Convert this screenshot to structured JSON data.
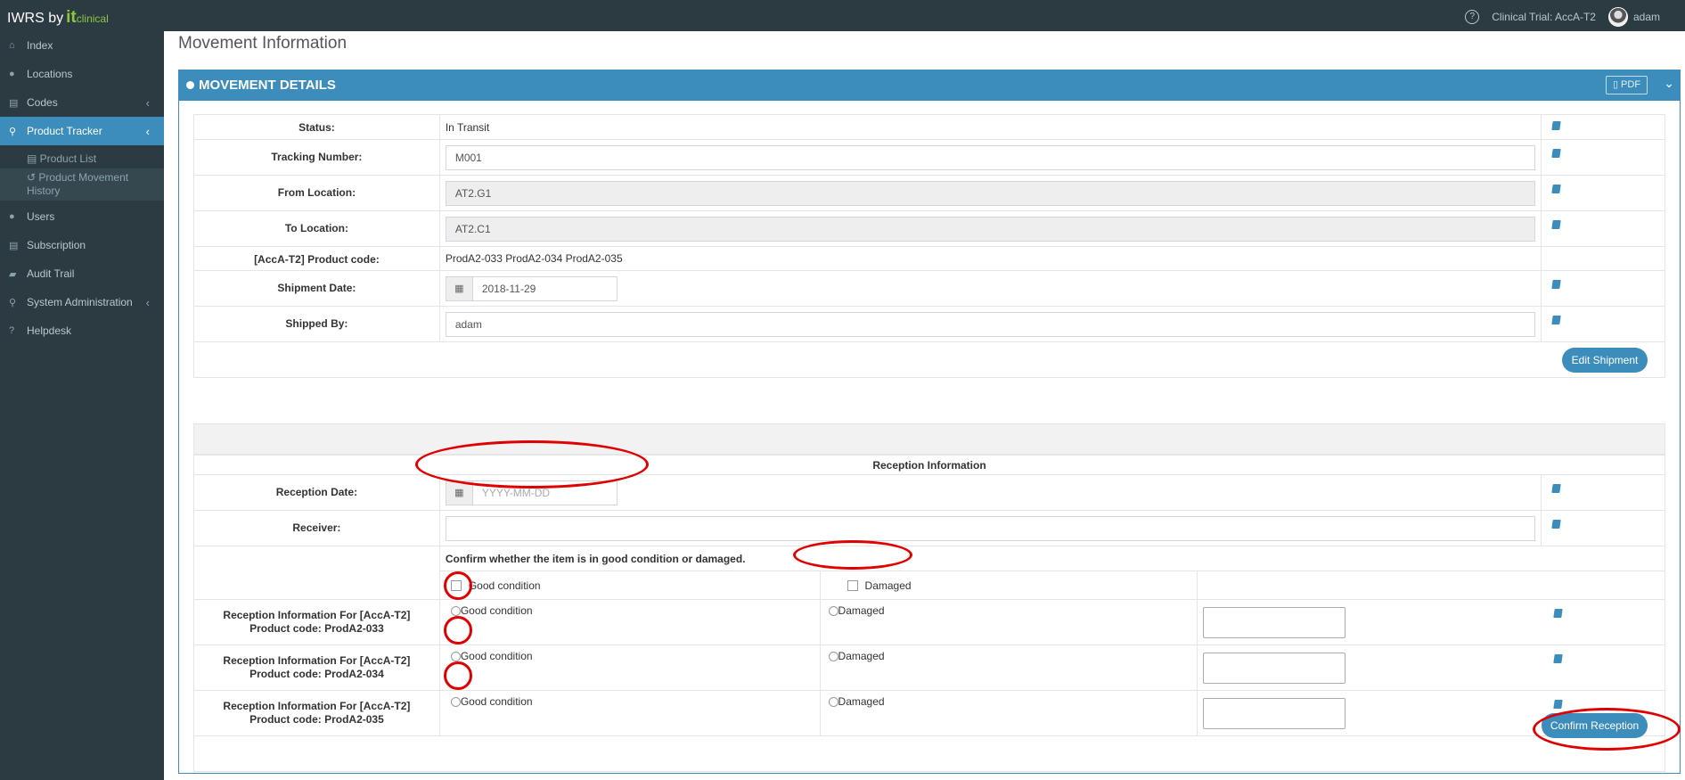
{
  "topbar": {
    "brand_prefix": "IWRS by",
    "brand_it": "it",
    "brand_clinical": "clinical",
    "help_label": "?",
    "trial": "Clinical Trial: AccA-T2",
    "user": "adam"
  },
  "sidebar": {
    "items": [
      {
        "label": "Index",
        "icon": "home-icon"
      },
      {
        "label": "Locations",
        "icon": "globe-icon"
      },
      {
        "label": "Codes",
        "icon": "table-icon"
      },
      {
        "label": "Product Tracker",
        "icon": "map-marker-icon"
      },
      {
        "label": "Users",
        "icon": "users-icon"
      },
      {
        "label": "Subscription",
        "icon": "table-icon"
      },
      {
        "label": "Audit Trail",
        "icon": "book-icon"
      },
      {
        "label": "System Administration",
        "icon": "map-marker-icon"
      },
      {
        "label": "Helpdesk",
        "icon": "question-icon"
      }
    ],
    "subitems": [
      {
        "label": "Product List",
        "icon": "table-icon"
      },
      {
        "label": "Product Movement History",
        "icon": "history-icon"
      }
    ]
  },
  "page": {
    "title": "Movement Information"
  },
  "box": {
    "title": "MOVEMENT DETAILS",
    "pdf_label": "PDF"
  },
  "movement": {
    "status_label": "Status:",
    "status_value": "In Transit",
    "tracking_label": "Tracking Number:",
    "tracking_value": "M001",
    "from_label": "From Location:",
    "from_value": "AT2.G1",
    "to_label": "To Location:",
    "to_value": "AT2.C1",
    "product_code_label": "[AccA-T2] Product code:",
    "product_code_value": "ProdA2-033 ProdA2-034 ProdA2-035",
    "shipment_date_label": "Shipment Date:",
    "shipment_date_value": "2018-11-29",
    "shipped_by_label": "Shipped By:",
    "shipped_by_value": "adam",
    "edit_button": "Edit Shipment"
  },
  "reception": {
    "header": "Reception Information",
    "date_label": "Reception Date:",
    "date_placeholder": "YYYY-MM-DD",
    "receiver_label": "Receiver:",
    "receiver_value": "",
    "confirm_prompt": "Confirm whether the item is in good condition or damaged.",
    "good_label": "Good condition",
    "damaged_label": "Damaged",
    "products": [
      {
        "label": "Reception Information For [AccA-T2] Product code: ProdA2-033"
      },
      {
        "label": "Reception Information For [AccA-T2] Product code: ProdA2-034"
      },
      {
        "label": "Reception Information For [AccA-T2] Product code: ProdA2-035"
      }
    ],
    "confirm_button": "Confirm Reception"
  },
  "colors": {
    "accent": "#3c8dbc",
    "sidebar": "#2c3b41",
    "annotation": "#e00000"
  }
}
